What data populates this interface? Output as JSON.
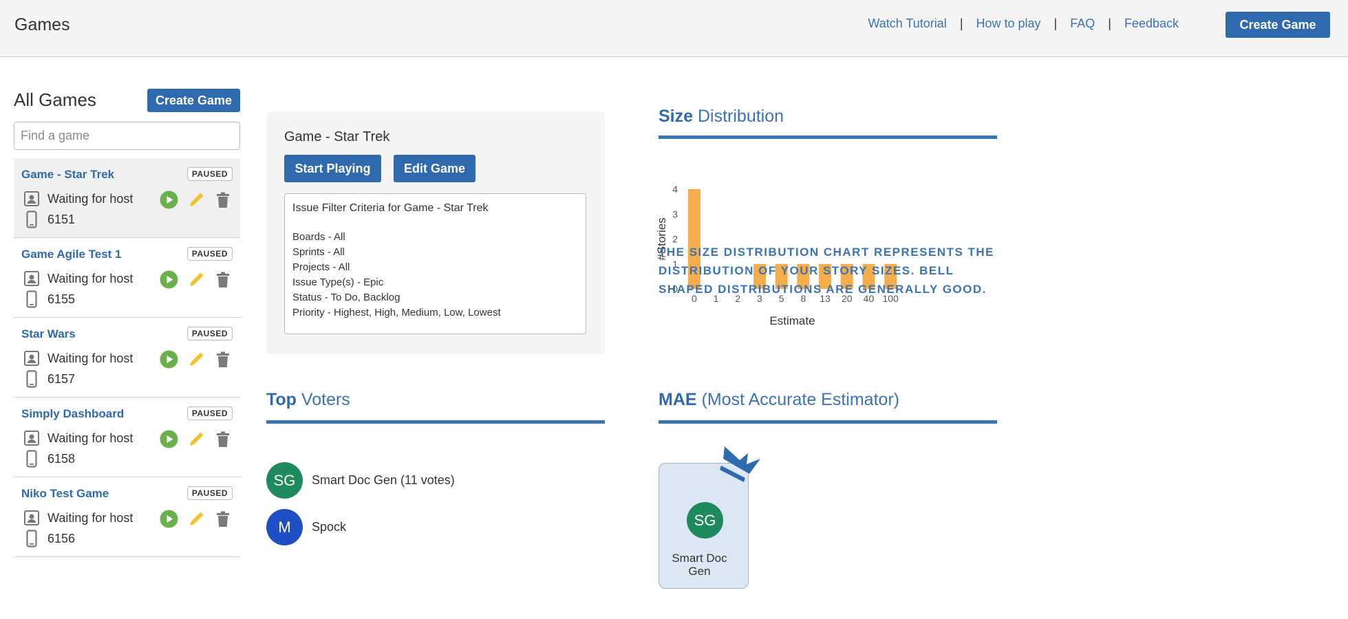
{
  "header": {
    "title": "Games",
    "nav": [
      "Watch Tutorial",
      "How to play",
      "FAQ",
      "Feedback"
    ],
    "create_label": "Create Game"
  },
  "sidebar": {
    "title": "All Games",
    "create_label": "Create Game",
    "search_placeholder": "Find a game",
    "games": [
      {
        "name": "Game - Star Trek",
        "status": "PAUSED",
        "host_status": "Waiting for host",
        "code": "6151",
        "active": true
      },
      {
        "name": "Game Agile Test 1",
        "status": "PAUSED",
        "host_status": "Waiting for host",
        "code": "6155",
        "active": false
      },
      {
        "name": "Star Wars",
        "status": "PAUSED",
        "host_status": "Waiting for host",
        "code": "6157",
        "active": false
      },
      {
        "name": "Simply Dashboard",
        "status": "PAUSED",
        "host_status": "Waiting for host",
        "code": "6158",
        "active": false
      },
      {
        "name": "Niko Test Game",
        "status": "PAUSED",
        "host_status": "Waiting for host",
        "code": "6156",
        "active": false
      }
    ]
  },
  "game_panel": {
    "title": "Game - Star Trek",
    "start_label": "Start Playing",
    "edit_label": "Edit Game",
    "filter_title": "Issue Filter Criteria for Game - Star Trek",
    "filters": [
      "Boards - All",
      "Sprints - All",
      "Projects - All",
      "Issue Type(s) - Epic",
      "Status - To Do, Backlog",
      "Priority - Highest, High, Medium, Low, Lowest"
    ]
  },
  "size_distribution": {
    "heading_bold": "Size",
    "heading_rest": "Distribution",
    "note": "The size distribution chart represents the distribution of your story sizes. Bell shaped distributions are generally good."
  },
  "chart_data": {
    "type": "bar",
    "categories": [
      "0",
      "1",
      "2",
      "3",
      "5",
      "8",
      "13",
      "20",
      "40",
      "100"
    ],
    "values": [
      4,
      0,
      0,
      1,
      1,
      1,
      1,
      1,
      1,
      1
    ],
    "xlabel": "Estimate",
    "ylabel": "#Stories",
    "ylim": [
      0,
      4
    ],
    "yticks": [
      "0",
      "1",
      "2",
      "3",
      "4"
    ],
    "bar_color": "#f5ad4b",
    "grid": false
  },
  "top_voters": {
    "heading_bold": "Top",
    "heading_rest": "Voters",
    "voters": [
      {
        "initials": "SG",
        "name": "Smart Doc Gen (11 votes)",
        "color": "#1e8a5e"
      },
      {
        "initials": "M",
        "name": "Spock",
        "color": "#1f4fc4"
      }
    ]
  },
  "mae": {
    "heading_bold": "MAE",
    "heading_rest": "(Most Accurate Estimator)",
    "initials": "SG",
    "name": "Smart Doc Gen",
    "color": "#1e8a5e"
  },
  "colors": {
    "primary": "#2f6aae",
    "link": "#3b73b4",
    "play": "#6ab04c",
    "edit": "#f2c12e",
    "delete": "#7a7a7a"
  }
}
